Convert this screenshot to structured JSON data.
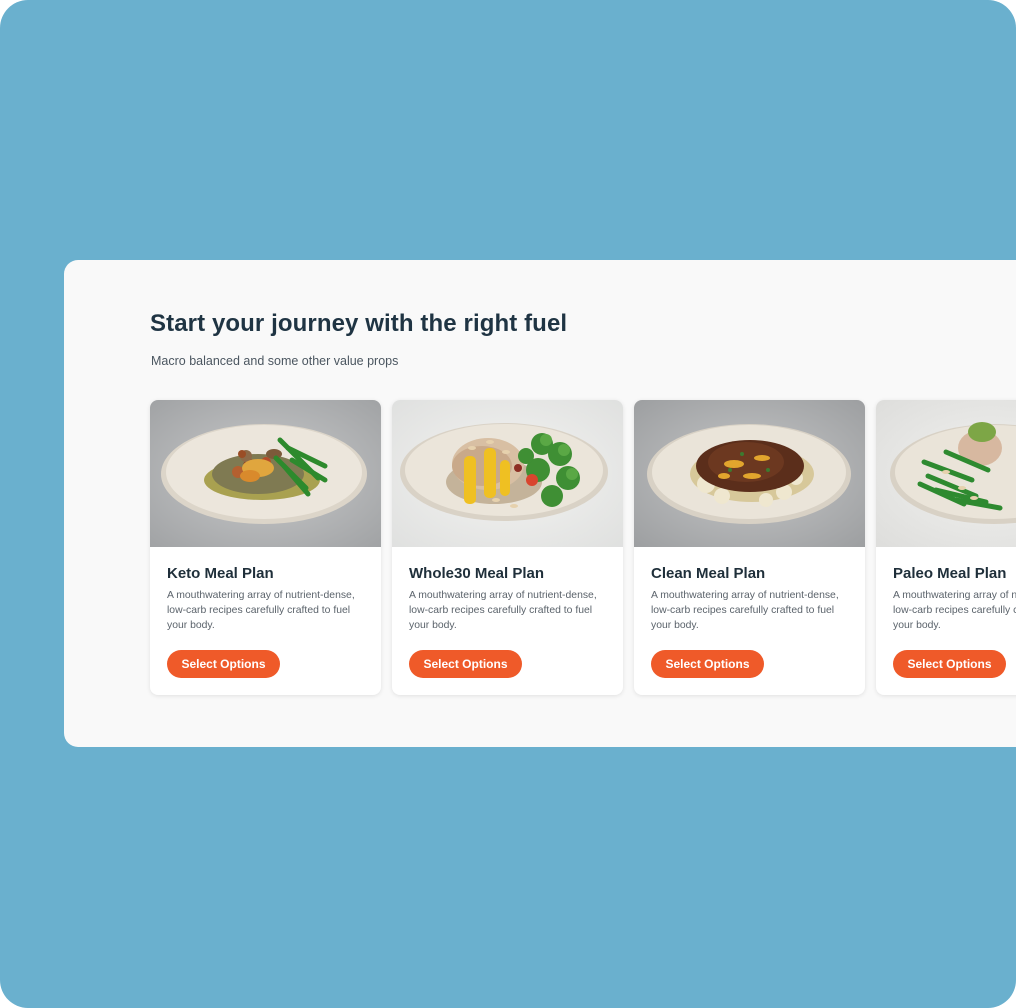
{
  "section": {
    "title": "Start your journey with the right fuel",
    "subtitle": "Macro balanced and some other value props"
  },
  "cards": [
    {
      "title": "Keto Meal Plan",
      "description": "A mouthwatering array of nutrient-dense, low-carb recipes carefully crafted to fuel your body.",
      "button": "Select Options"
    },
    {
      "title": "Whole30 Meal Plan",
      "description": "A mouthwatering array of nutrient-dense, low-carb recipes carefully crafted to fuel your body.",
      "button": "Select Options"
    },
    {
      "title": "Clean Meal Plan",
      "description": "A mouthwatering array of nutrient-dense, low-carb recipes carefully crafted to fuel your body.",
      "button": "Select Options"
    },
    {
      "title": "Paleo Meal Plan",
      "description": "A mouthwatering array of nutrient-dense, low-carb recipes carefully crafted to fuel your body.",
      "button": "Select Options"
    }
  ],
  "colors": {
    "background": "#6ab0ce",
    "panel": "#f9f9f9",
    "accent": "#ef5a29",
    "heading": "#1f3443"
  }
}
